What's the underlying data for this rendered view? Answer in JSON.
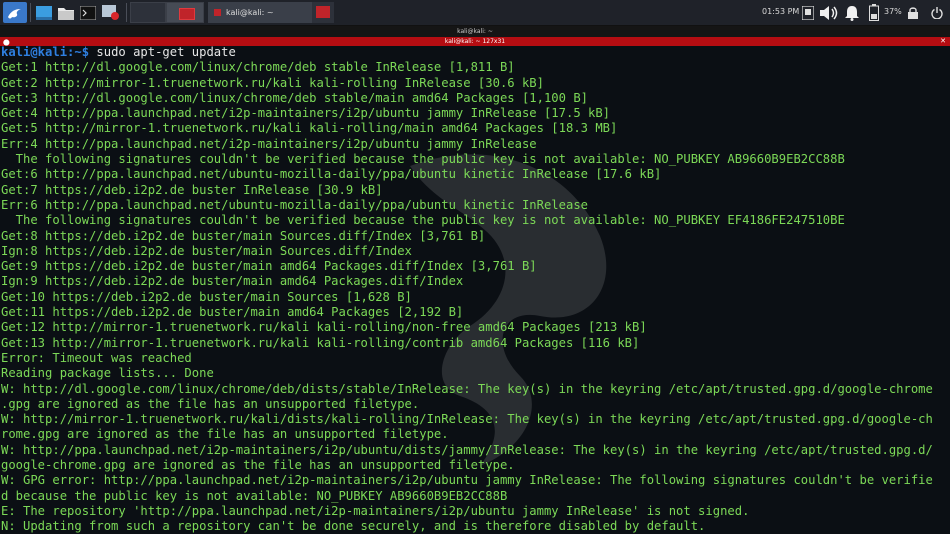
{
  "taskbar": {
    "menu_icon": "kali-dragon-icon",
    "task_label": "kali@kali: ~",
    "clock": "01:53 PM",
    "battery_percent": "37%"
  },
  "window": {
    "title": "kali@kali: ~",
    "tab_title": "kali@kali: ~ 127x31"
  },
  "terminal": {
    "prompt_user": "kali@kali",
    "prompt_sep": ":~$",
    "command": " sudo apt-get update",
    "lines": [
      "Get:1 http://dl.google.com/linux/chrome/deb stable InRelease [1,811 B]",
      "Get:2 http://mirror-1.truenetwork.ru/kali kali-rolling InRelease [30.6 kB]",
      "Get:3 http://dl.google.com/linux/chrome/deb stable/main amd64 Packages [1,100 B]",
      "Get:4 http://ppa.launchpad.net/i2p-maintainers/i2p/ubuntu jammy InRelease [17.5 kB]",
      "Get:5 http://mirror-1.truenetwork.ru/kali kali-rolling/main amd64 Packages [18.3 MB]",
      "Err:4 http://ppa.launchpad.net/i2p-maintainers/i2p/ubuntu jammy InRelease",
      "  The following signatures couldn't be verified because the public key is not available: NO_PUBKEY AB9660B9EB2CC88B",
      "Get:6 http://ppa.launchpad.net/ubuntu-mozilla-daily/ppa/ubuntu kinetic InRelease [17.6 kB]",
      "Get:7 https://deb.i2p2.de buster InRelease [30.9 kB]",
      "Err:6 http://ppa.launchpad.net/ubuntu-mozilla-daily/ppa/ubuntu kinetic InRelease",
      "  The following signatures couldn't be verified because the public key is not available: NO_PUBKEY EF4186FE247510BE",
      "Get:8 https://deb.i2p2.de buster/main Sources.diff/Index [3,761 B]",
      "Ign:8 https://deb.i2p2.de buster/main Sources.diff/Index",
      "Get:9 https://deb.i2p2.de buster/main amd64 Packages.diff/Index [3,761 B]",
      "Ign:9 https://deb.i2p2.de buster/main amd64 Packages.diff/Index",
      "Get:10 https://deb.i2p2.de buster/main Sources [1,628 B]",
      "Get:11 https://deb.i2p2.de buster/main amd64 Packages [2,192 B]",
      "Get:12 http://mirror-1.truenetwork.ru/kali kali-rolling/non-free amd64 Packages [213 kB]",
      "Get:13 http://mirror-1.truenetwork.ru/kali kali-rolling/contrib amd64 Packages [116 kB]",
      "Error: Timeout was reached",
      "Reading package lists... Done",
      "W: http://dl.google.com/linux/chrome/deb/dists/stable/InRelease: The key(s) in the keyring /etc/apt/trusted.gpg.d/google-chrome",
      ".gpg are ignored as the file has an unsupported filetype.",
      "W: http://mirror-1.truenetwork.ru/kali/dists/kali-rolling/InRelease: The key(s) in the keyring /etc/apt/trusted.gpg.d/google-ch",
      "rome.gpg are ignored as the file has an unsupported filetype.",
      "W: http://ppa.launchpad.net/i2p-maintainers/i2p/ubuntu/dists/jammy/InRelease: The key(s) in the keyring /etc/apt/trusted.gpg.d/",
      "google-chrome.gpg are ignored as the file has an unsupported filetype.",
      "W: GPG error: http://ppa.launchpad.net/i2p-maintainers/i2p/ubuntu jammy InRelease: The following signatures couldn't be verifie",
      "d because the public key is not available: NO_PUBKEY AB9660B9EB2CC88B",
      "E: The repository 'http://ppa.launchpad.net/i2p-maintainers/i2p/ubuntu jammy InRelease' is not signed.",
      "N: Updating from such a repository can't be done securely, and is therefore disabled by default."
    ]
  },
  "colors": {
    "terminal_text": "#7cd957",
    "prompt": "#2f7fe0",
    "tab_bar": "#b50d12",
    "taskbar": "#1f2229"
  }
}
